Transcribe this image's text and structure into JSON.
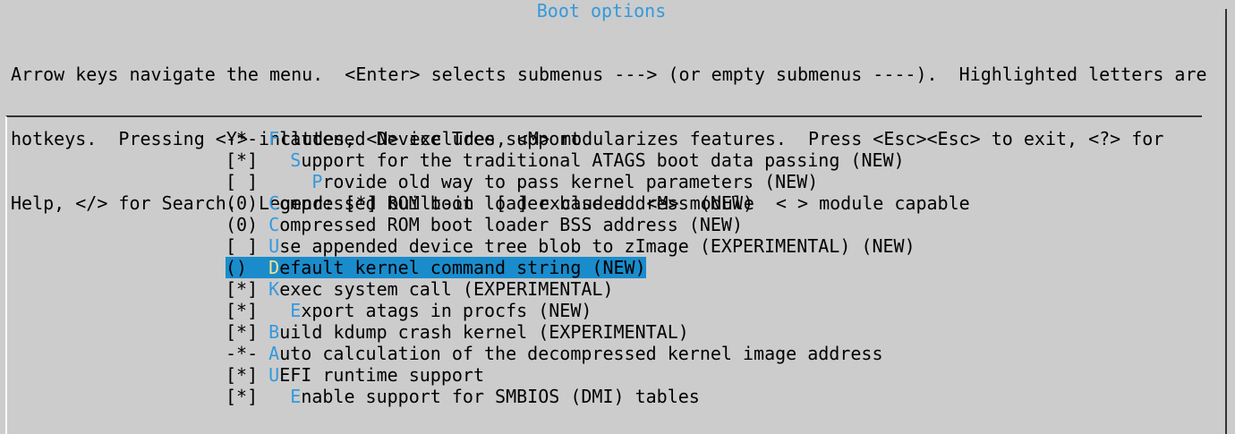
{
  "window": {
    "title": "Boot options"
  },
  "help_lines": [
    "Arrow keys navigate the menu.  <Enter> selects submenus ---> (or empty submenus ----).  Highlighted letters are",
    "hotkeys.  Pressing <Y> includes, <N> excludes, <M> modularizes features.  Press <Esc><Esc> to exit, <?> for",
    "Help, </> for Search.  Legend: [*] built-in  [ ] excluded  <M> module  < > module capable"
  ],
  "colors": {
    "background": "#cccccc",
    "hotkey": "#3399dd",
    "selection_background": "#1a8ccc",
    "selection_hotkey": "#f5e38a"
  },
  "menu_items": [
    {
      "marker": "-*- ",
      "indent": "",
      "hotkey": "F",
      "label": "lattened Device Tree support",
      "selected": false
    },
    {
      "marker": "[*] ",
      "indent": "  ",
      "hotkey": "S",
      "label": "upport for the traditional ATAGS boot data passing (NEW)",
      "selected": false
    },
    {
      "marker": "[ ] ",
      "indent": "    ",
      "hotkey": "P",
      "label": "rovide old way to pass kernel parameters (NEW)",
      "selected": false
    },
    {
      "marker": "(0) ",
      "indent": "",
      "hotkey": "C",
      "label": "ompressed ROM boot loader base address (NEW)",
      "selected": false
    },
    {
      "marker": "(0) ",
      "indent": "",
      "hotkey": "C",
      "label": "ompressed ROM boot loader BSS address (NEW)",
      "selected": false
    },
    {
      "marker": "[ ] ",
      "indent": "",
      "hotkey": "U",
      "label": "se appended device tree blob to zImage (EXPERIMENTAL) (NEW)",
      "selected": false
    },
    {
      "marker": "()  ",
      "indent": "",
      "hotkey": "D",
      "label": "efault kernel command string (NEW)",
      "selected": true
    },
    {
      "marker": "[*] ",
      "indent": "",
      "hotkey": "K",
      "label": "exec system call (EXPERIMENTAL)",
      "selected": false
    },
    {
      "marker": "[*] ",
      "indent": "  ",
      "hotkey": "E",
      "label": "xport atags in procfs (NEW)",
      "selected": false
    },
    {
      "marker": "[*] ",
      "indent": "",
      "hotkey": "B",
      "label": "uild kdump crash kernel (EXPERIMENTAL)",
      "selected": false
    },
    {
      "marker": "-*- ",
      "indent": "",
      "hotkey": "A",
      "label": "uto calculation of the decompressed kernel image address",
      "selected": false
    },
    {
      "marker": "[*] ",
      "indent": "",
      "hotkey": "U",
      "label": "EFI runtime support",
      "selected": false
    },
    {
      "marker": "[*] ",
      "indent": "  ",
      "hotkey": "E",
      "label": "nable support for SMBIOS (DMI) tables",
      "selected": false
    }
  ]
}
